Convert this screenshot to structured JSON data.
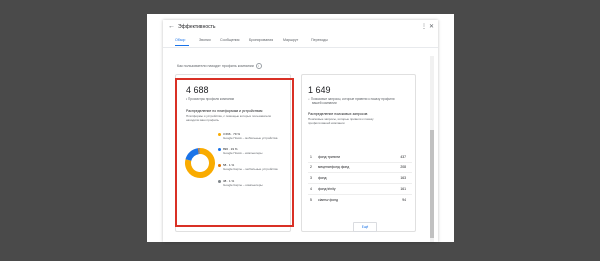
{
  "header": {
    "back_icon": "←",
    "title": "Эффективность",
    "more_icon": "⋮",
    "close_icon": "✕"
  },
  "tabs": [
    {
      "label": "Обзор",
      "active": true
    },
    {
      "label": "Звонки",
      "active": false
    },
    {
      "label": "Сообщения",
      "active": false
    },
    {
      "label": "Бронирования",
      "active": false
    },
    {
      "label": "Маршрут",
      "active": false
    },
    {
      "label": "Переходы",
      "active": false
    }
  ],
  "info_line": "Как пользователи находят профиль компании",
  "left_card": {
    "count": "4 688",
    "count_label": "Просмотры профиля компании",
    "section_title": "Распределение по платформам и устройствам",
    "section_desc_1": "Платформы и устройства, с помощью которых пользователи",
    "section_desc_2": "находили ваш профиль",
    "legend": [
      {
        "line1": "3 696 · 79 %",
        "line2": "Google Поиск – мобильные устройства",
        "color": "#f9ab00"
      },
      {
        "line1": "896 · 19 %",
        "line2": "Google Поиск – компьютеры",
        "color": "#1a73e8"
      },
      {
        "line1": "58 · 1 %",
        "line2": "Google Карты – мобильные устройства",
        "color": "#e37400"
      },
      {
        "line1": "38 · 1 %",
        "line2": "Google Карты – компьютеры",
        "color": "#80868b"
      }
    ]
  },
  "donut": [
    79,
    19,
    1,
    1
  ],
  "right_card": {
    "count": "1 649",
    "count_label_1": "Поисковые запросы, которые привели к показу профиля",
    "count_label_2": "вашей компании",
    "section_title": "Распределение поисковых запросов",
    "section_desc_1": "Поисковые запросы, которые привели к показу",
    "section_desc_2": "профиля вашей компании",
    "rows": [
      {
        "n": "1",
        "text": "фонд тринити",
        "value": "437"
      },
      {
        "n": "2",
        "text": "меценатфонд фонд",
        "value": "208"
      },
      {
        "n": "3",
        "text": "фонд",
        "value": "163"
      },
      {
        "n": "4",
        "text": "фонд trinity",
        "value": "161"
      },
      {
        "n": "5",
        "text": "ciamsv фонд",
        "value": "94"
      }
    ],
    "button": "Ещё"
  }
}
